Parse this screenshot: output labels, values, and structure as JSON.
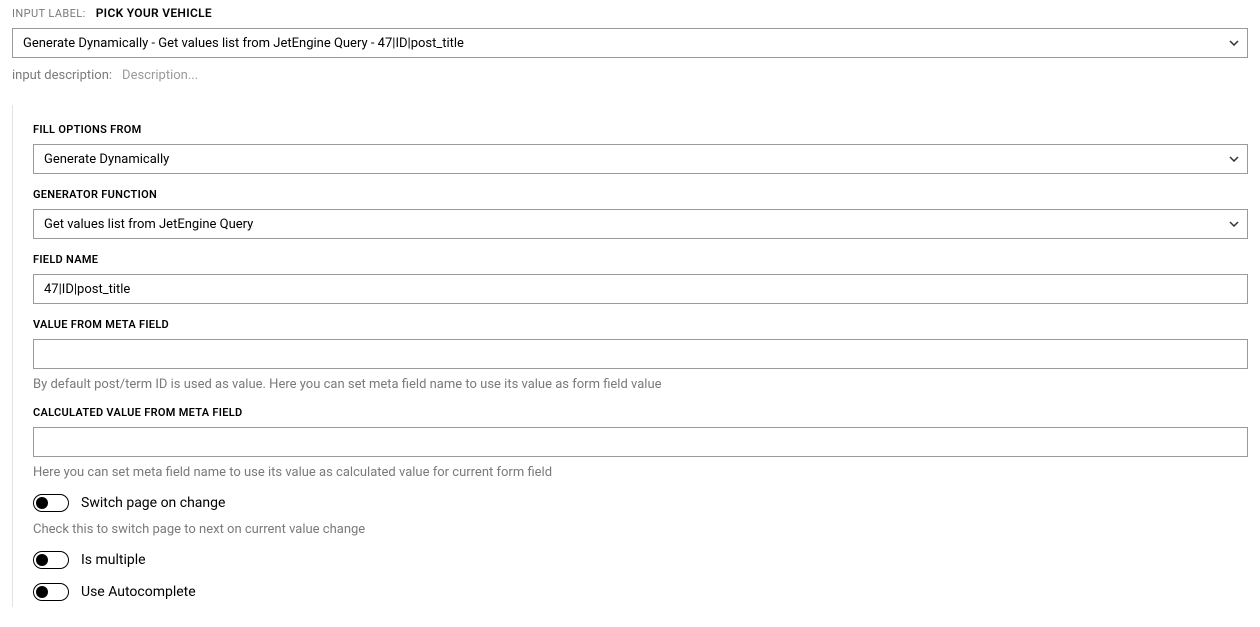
{
  "header": {
    "input_label_caption": "INPUT LABEL:",
    "input_label_value": "PICK YOUR VEHICLE",
    "main_select_text": "Generate Dynamically - Get values list from JetEngine Query - 47|ID|post_title",
    "input_description_caption": "input description:",
    "input_description_placeholder": "Description..."
  },
  "panel": {
    "fill_options_from": {
      "label": "FILL OPTIONS FROM",
      "value": "Generate Dynamically"
    },
    "generator_function": {
      "label": "GENERATOR FUNCTION",
      "value": "Get values list from JetEngine Query"
    },
    "field_name": {
      "label": "FIELD NAME",
      "value": "47|ID|post_title"
    },
    "value_from_meta": {
      "label": "VALUE FROM META FIELD",
      "value": "",
      "help": "By default post/term ID is used as value. Here you can set meta field name to use its value as form field value"
    },
    "calculated_value_from_meta": {
      "label": "CALCULATED VALUE FROM META FIELD",
      "value": "",
      "help": "Here you can set meta field name to use its value as calculated value for current form field"
    },
    "switch_page": {
      "label": "Switch page on change",
      "help": "Check this to switch page to next on current value change"
    },
    "is_multiple": {
      "label": "Is multiple"
    },
    "use_autocomplete": {
      "label": "Use Autocomplete"
    }
  }
}
